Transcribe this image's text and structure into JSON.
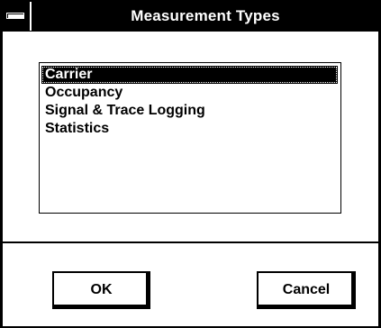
{
  "window": {
    "title": "Measurement Types",
    "system_menu_icon": "system-menu-bar"
  },
  "list": {
    "items": [
      {
        "label": "Carrier",
        "selected": true
      },
      {
        "label": "Occupancy",
        "selected": false
      },
      {
        "label": "Signal & Trace Logging",
        "selected": false
      },
      {
        "label": "Statistics",
        "selected": false
      }
    ]
  },
  "buttons": {
    "ok_label": "OK",
    "cancel_label": "Cancel"
  },
  "colors": {
    "titlebar_bg": "#000000",
    "titlebar_text": "#ffffff",
    "selection_bg": "#000000",
    "selection_text": "#ffffff",
    "window_bg": "#ffffff"
  }
}
